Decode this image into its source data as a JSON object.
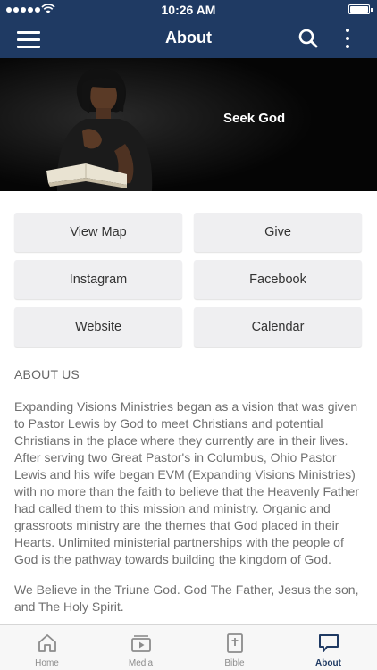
{
  "status_bar": {
    "time": "10:26 AM"
  },
  "nav": {
    "title": "About"
  },
  "hero": {
    "caption": "Seek God"
  },
  "buttons": [
    {
      "label": "View Map"
    },
    {
      "label": "Give"
    },
    {
      "label": "Instagram"
    },
    {
      "label": "Facebook"
    },
    {
      "label": "Website"
    },
    {
      "label": "Calendar"
    }
  ],
  "about": {
    "heading": "ABOUT US",
    "body": "Expanding Visions Ministries began as a vision that was given to Pastor Lewis by God to meet Christians and potential Christians in the place where they currently are in their lives. After serving two Great Pastor's in Columbus, Ohio Pastor Lewis and his wife began EVM (Expanding Visions Ministries) with no more than the faith to believe that the Heavenly Father had called them to this mission and ministry. Organic and grassroots ministry are the themes that God placed in their Hearts. Unlimited ministerial partnerships with the people of God is the pathway towards building the kingdom of God.",
    "belief": "We Believe in the Triune God. God The Father, Jesus the son, and The Holy Spirit."
  },
  "tabs": [
    {
      "label": "Home",
      "icon": "home-icon"
    },
    {
      "label": "Media",
      "icon": "media-icon"
    },
    {
      "label": "Bible",
      "icon": "bible-icon"
    },
    {
      "label": "About",
      "icon": "chat-icon"
    }
  ],
  "colors": {
    "nav_bar": "#1f3a63",
    "button_bg": "#efeff1",
    "active_tab": "#1f3a63"
  }
}
